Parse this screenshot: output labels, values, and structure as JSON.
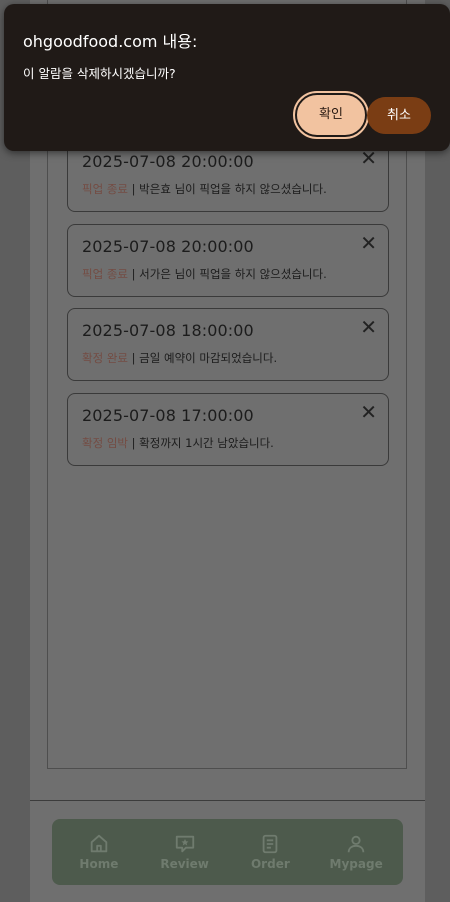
{
  "dialog": {
    "title": "ohgoodfood.com 내용:",
    "message": "이 알람을 삭제하시겠습니까?",
    "confirm_label": "확인",
    "cancel_label": "취소",
    "colors": {
      "background": "#201a17",
      "confirm": "#f2c3a0",
      "cancel": "#7a3d14"
    }
  },
  "notifications": [
    {
      "time": "2025-07-08 20:00:00",
      "category": "픽업 종료",
      "separator": " | ",
      "message": "박은효 님이 픽업을 하지 않으셨습니다.",
      "close_icon": "close-icon"
    },
    {
      "time": "2025-07-08 20:00:00",
      "category": "픽업 종료",
      "separator": " | ",
      "message": "서가은 님이 픽업을 하지 않으셨습니다.",
      "close_icon": "close-icon"
    },
    {
      "time": "2025-07-08 18:00:00",
      "category": "확정 완료",
      "separator": " | ",
      "message": "금일 예약이 마감되었습니다.",
      "close_icon": "close-icon"
    },
    {
      "time": "2025-07-08 17:00:00",
      "category": "확정 임박",
      "separator": " | ",
      "message": "확정까지 1시간 남았습니다.",
      "close_icon": "close-icon"
    }
  ],
  "bottom_nav": {
    "items": [
      {
        "label": "Home",
        "icon": "home-icon"
      },
      {
        "label": "Review",
        "icon": "review-icon"
      },
      {
        "label": "Order",
        "icon": "order-icon"
      },
      {
        "label": "Mypage",
        "icon": "user-icon"
      }
    ]
  }
}
